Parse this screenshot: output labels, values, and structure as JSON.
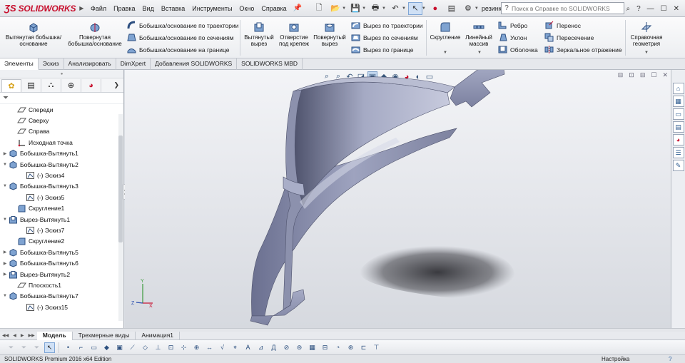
{
  "app": {
    "logo": "SOLIDWORKS",
    "doc_name": "резинк..."
  },
  "menu": [
    "Файл",
    "Правка",
    "Вид",
    "Вставка",
    "Инструменты",
    "Окно",
    "Справка"
  ],
  "search": {
    "placeholder": "Поиск в Справке по SOLIDWORKS"
  },
  "commands": {
    "extruded_boss": "Вытянутая бобышка/основание",
    "revolved_boss": "Повернутая бобышка/основание",
    "swept_boss": "Бобышка/основание по траектории",
    "lofted_boss": "Бобышка/основание по сечениям",
    "boundary_boss": "Бобышка/основание на границе",
    "extruded_cut": "Вытянутый вырез",
    "hole_wizard": "Отверстие под крепеж",
    "revolved_cut": "Повернутый вырез",
    "swept_cut": "Вырез по траектории",
    "lofted_cut": "Вырез по сечениям",
    "boundary_cut": "Вырез по границе",
    "fillet": "Скругление",
    "linear_pattern": "Линейный массив",
    "rib": "Ребро",
    "draft": "Уклон",
    "shell": "Оболочка",
    "move": "Перенос",
    "intersect": "Пересечение",
    "mirror": "Зеркальное отражение",
    "ref_geometry": "Справочная геометрия"
  },
  "tabs": [
    "Элементы",
    "Эскиз",
    "Анализировать",
    "DimXpert",
    "Добавления SOLIDWORKS",
    "SOLIDWORKS MBD"
  ],
  "tree": [
    {
      "label": "Спереди",
      "indent": 1,
      "expander": "",
      "icon": "plane"
    },
    {
      "label": "Сверху",
      "indent": 1,
      "expander": "",
      "icon": "plane"
    },
    {
      "label": "Справа",
      "indent": 1,
      "expander": "",
      "icon": "plane"
    },
    {
      "label": "Исходная точка",
      "indent": 1,
      "expander": "",
      "icon": "origin"
    },
    {
      "label": "Бобышка-Вытянуть1",
      "indent": 0,
      "expander": "▶",
      "icon": "boss"
    },
    {
      "label": "Бобышка-Вытянуть2",
      "indent": 0,
      "expander": "▼",
      "icon": "boss"
    },
    {
      "label": "(-) Эскиз4",
      "indent": 2,
      "expander": "",
      "icon": "sketch"
    },
    {
      "label": "Бобышка-Вытянуть3",
      "indent": 0,
      "expander": "▼",
      "icon": "boss"
    },
    {
      "label": "(-) Эскиз5",
      "indent": 2,
      "expander": "",
      "icon": "sketch"
    },
    {
      "label": "Скругление1",
      "indent": 1,
      "expander": "",
      "icon": "fillet"
    },
    {
      "label": "Вырез-Вытянуть1",
      "indent": 0,
      "expander": "▼",
      "icon": "cut"
    },
    {
      "label": "(-) Эскиз7",
      "indent": 2,
      "expander": "",
      "icon": "sketch"
    },
    {
      "label": "Скругление2",
      "indent": 1,
      "expander": "",
      "icon": "fillet"
    },
    {
      "label": "Бобышка-Вытянуть5",
      "indent": 0,
      "expander": "▶",
      "icon": "boss"
    },
    {
      "label": "Бобышка-Вытянуть6",
      "indent": 0,
      "expander": "▶",
      "icon": "boss"
    },
    {
      "label": "Вырез-Вытянуть2",
      "indent": 0,
      "expander": "▶",
      "icon": "cut"
    },
    {
      "label": "Плоскость1",
      "indent": 1,
      "expander": "",
      "icon": "plane"
    },
    {
      "label": "Бобышка-Вытянуть7",
      "indent": 0,
      "expander": "▼",
      "icon": "boss"
    },
    {
      "label": "(-) Эскиз15",
      "indent": 2,
      "expander": "",
      "icon": "sketch"
    }
  ],
  "bottom_tabs": [
    "Модель",
    "Трехмерные виды",
    "Анимация1"
  ],
  "status": {
    "edition": "SOLIDWORKS Premium 2016 x64 Edition",
    "settings": "Настройка",
    "help": "?"
  },
  "colors": {
    "accent": "#c8102e",
    "part": "#8f94b0",
    "part_dark": "#5e6382",
    "selection": "#cfe0f5"
  }
}
